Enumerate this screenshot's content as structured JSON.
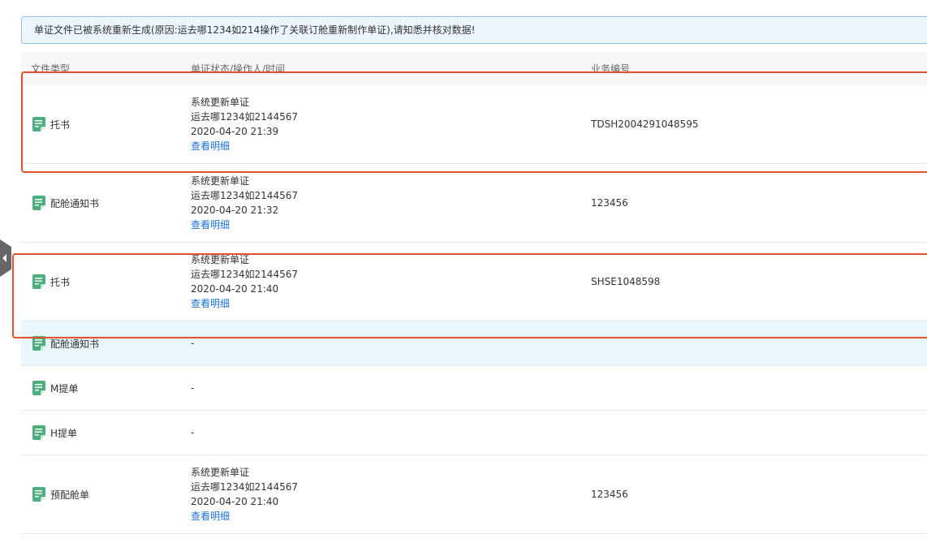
{
  "notice": {
    "text": "单证文件已被系统重新生成(原因:运去哪1234如214操作了关联订舱重新制作单证),请知悉并核对数据!"
  },
  "table": {
    "headers": {
      "file_type": "文件类型",
      "status": "单证状态/操作人/时间",
      "business_no": "业务编号"
    },
    "rows": [
      {
        "file_type": "托书",
        "status": "系统更新单证",
        "operator": "运去哪1234如2144567",
        "time": "2020-04-20 21:39",
        "link": "查看明细",
        "business_no": "TDSH2004291048595"
      },
      {
        "file_type": "配舱通知书",
        "status": "系统更新单证",
        "operator": "运去哪1234如2144567",
        "time": "2020-04-20 21:32",
        "link": "查看明细",
        "business_no": "123456"
      },
      {
        "file_type": "托书",
        "status": "系统更新单证",
        "operator": "运去哪1234如2144567",
        "time": "2020-04-20 21:40",
        "link": "查看明细",
        "business_no": "SHSE1048598"
      },
      {
        "file_type": "配舱通知书",
        "status": "-",
        "business_no": ""
      },
      {
        "file_type": "M提单",
        "status": "-",
        "business_no": ""
      },
      {
        "file_type": "H提单",
        "status": "-",
        "business_no": ""
      },
      {
        "file_type": "预配舱单",
        "status": "系统更新单证",
        "operator": "运去哪1234如2144567",
        "time": "2020-04-20 21:40",
        "link": "查看明细",
        "business_no": "123456"
      }
    ]
  },
  "colors": {
    "icon": "#4caf7d",
    "link": "#1a73d9",
    "highlight_box": "#e0532e",
    "notice_bg": "#ebf5fd",
    "hover_row": "#e9f6fb"
  },
  "icons": {
    "file_type": "document-icon",
    "side_toggle": "caret-left-icon"
  }
}
